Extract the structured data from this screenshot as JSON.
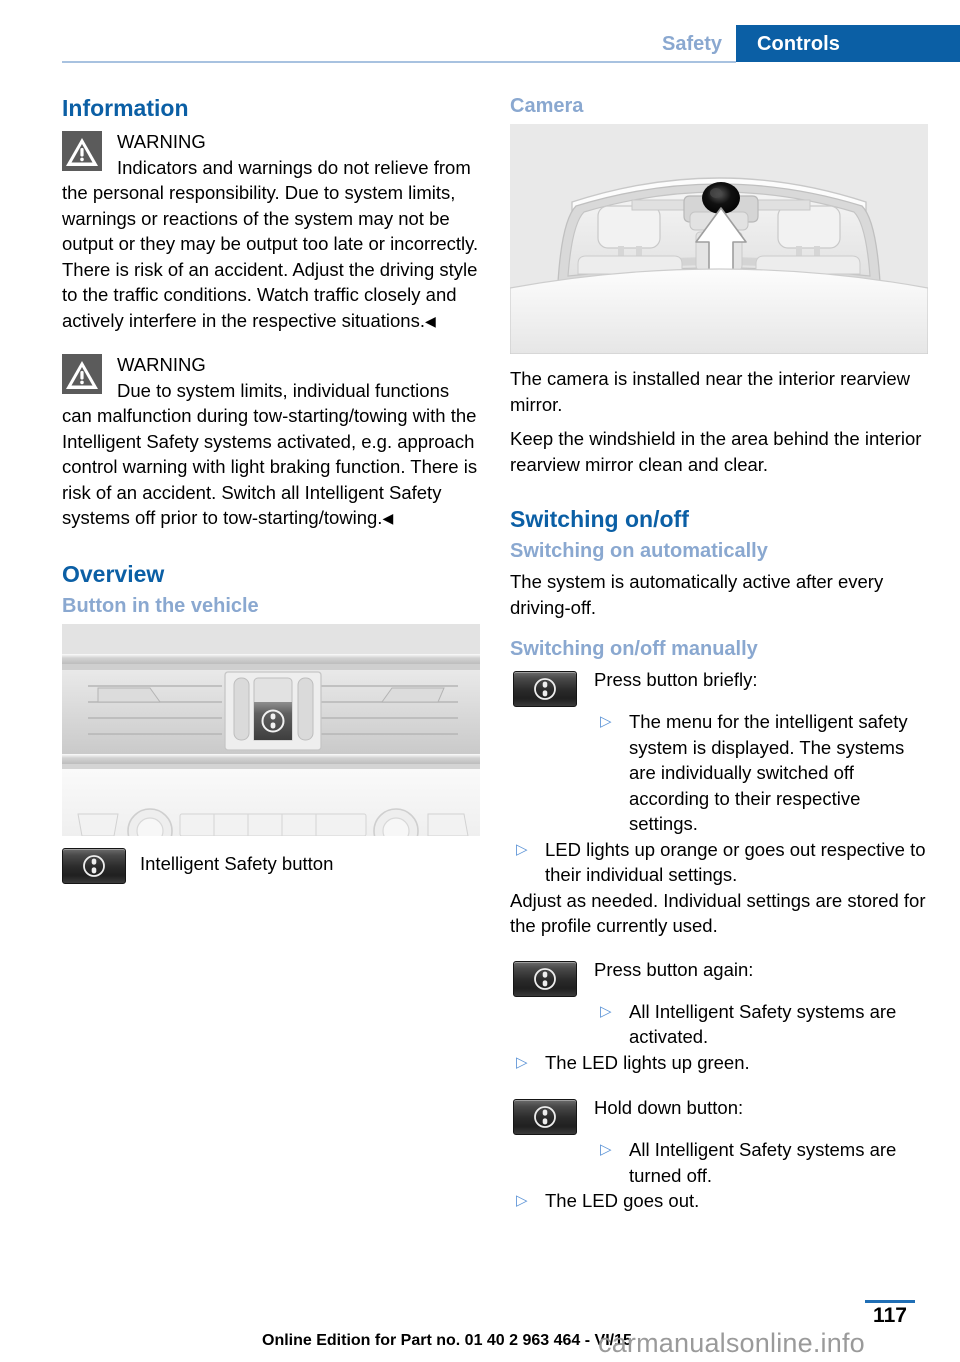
{
  "header": {
    "breadcrumb_section": "Safety",
    "active_tab": "Controls",
    "accent_dark": "#0b5fa5",
    "accent_light": "#8aa8d0"
  },
  "left_column": {
    "heading": "Information",
    "warnings": [
      {
        "label": "WARNING",
        "text": "Indicators and warnings do not relieve from the personal responsibility. Due to system limits, warnings or reactions of the system may not be output or they may be output too late or incorrectly. There is risk of an accident. Adjust the driving style to the traffic conditions. Watch traffic closely and actively interfere in the respective situations.",
        "end_mark": "◀"
      },
      {
        "label": "WARNING",
        "text": "Due to system limits, individual functions can malfunction during tow-starting/towing with the Intelligent Safety systems activated, e.g. approach control warning with light braking function. There is risk of an accident. Switch all Intelligent Safety systems off prior to tow-starting/towing.",
        "end_mark": "◀"
      }
    ],
    "overview_heading": "Overview",
    "button_subheading": "Button in the vehicle",
    "dashboard_figure_alt": "dashboard-center-console-illustration",
    "button_caption": "Intelligent Safety button"
  },
  "right_column": {
    "camera_heading": "Camera",
    "camera_figure_alt": "windshield-camera-illustration",
    "camera_paragraphs": [
      "The camera is installed near the interior rearview mirror.",
      "Keep the windshield in the area behind the interior rearview mirror clean and clear."
    ],
    "switching_heading": "Switching on/off",
    "auto_subheading": "Switching on automatically",
    "auto_paragraph": "The system is automatically active after every driving-off.",
    "manual_subheading": "Switching on/off manually",
    "steps": [
      {
        "title": "Press button briefly:",
        "bullets": [
          "The menu for the intelligent safety system is displayed. The systems are individually switched off according to their respective settings."
        ]
      },
      {
        "title": "Press button again:",
        "bullets": [
          "All Intelligent Safety systems are activated."
        ]
      },
      {
        "title": "Hold down button:",
        "bullets": [
          "All Intelligent Safety systems are turned off."
        ]
      }
    ],
    "outer_bullets": {
      "after_step1": "LED lights up orange or goes out respective to their individual settings.",
      "after_step2": "The LED lights up green.",
      "after_step3": "The LED goes out."
    },
    "adjust_paragraph": "Adjust as needed. Individual settings are stored for the profile currently used.",
    "bullet_marker": "▷",
    "bullet_color": "#5b93d6"
  },
  "footer": {
    "page_number": "117",
    "edition_note": "Online Edition for Part no. 01 40 2 963 464 - VI/15",
    "watermark": "carmanualsonline.info"
  }
}
